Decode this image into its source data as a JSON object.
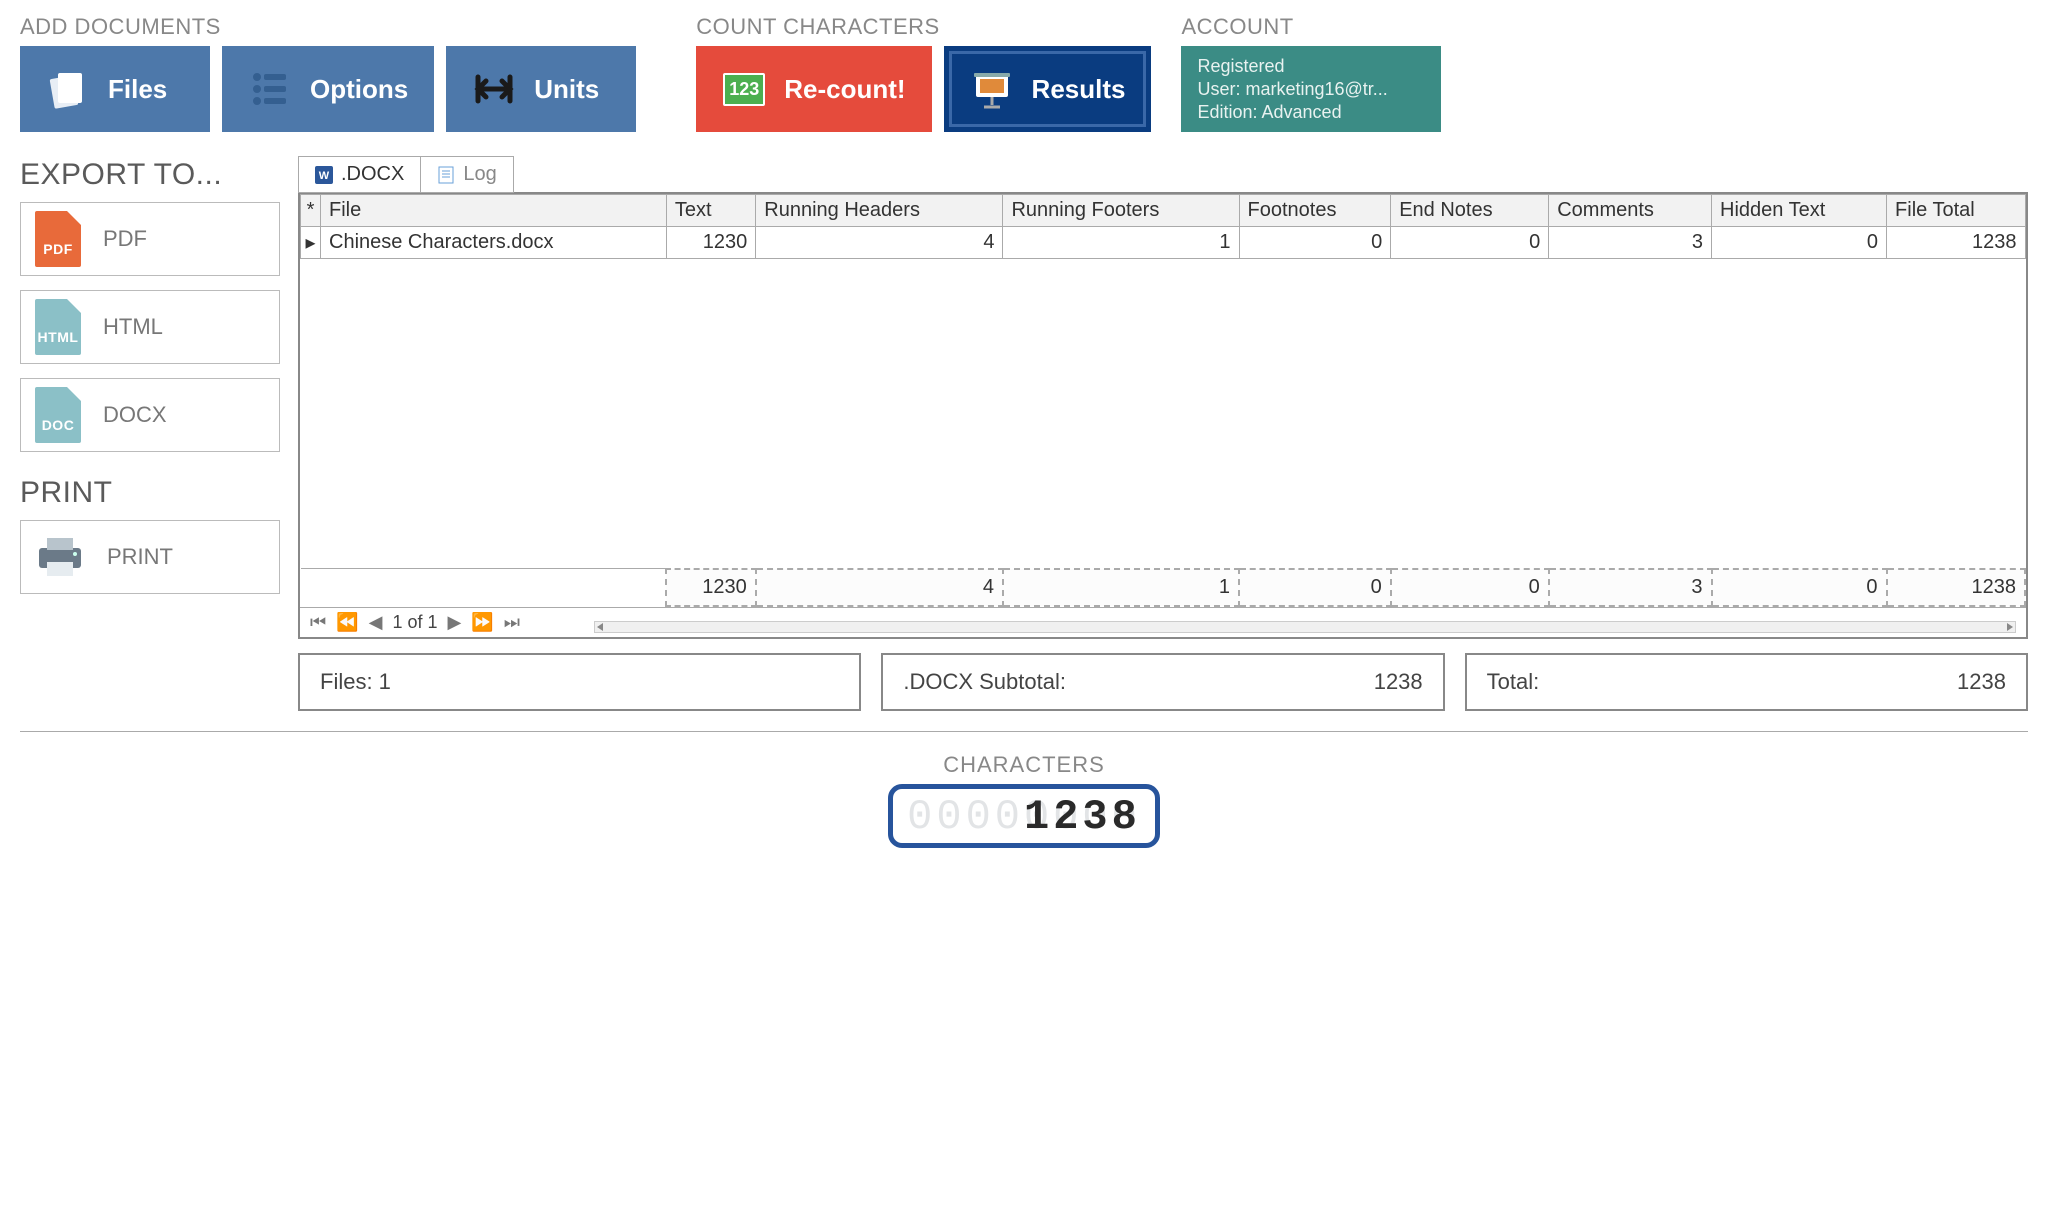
{
  "header": {
    "groups": {
      "add": "ADD DOCUMENTS",
      "count": "COUNT CHARACTERS",
      "account": "ACCOUNT"
    },
    "buttons": {
      "files": "Files",
      "options": "Options",
      "units": "Units",
      "recount": "Re-count!",
      "results": "Results"
    },
    "account": {
      "line1": "Registered",
      "line2": "User: marketing16@tr...",
      "line3": "Edition: Advanced"
    }
  },
  "sidebar": {
    "export_title": "EXPORT TO...",
    "pdf": "PDF",
    "html": "HTML",
    "docx": "DOCX",
    "print_title": "PRINT",
    "print": "PRINT",
    "icon_pdf": "PDF",
    "icon_html": "HTML",
    "icon_docx": "DOC"
  },
  "tabs": {
    "docx": ".DOCX",
    "log": "Log"
  },
  "grid": {
    "star": "*",
    "marker": "▸",
    "cols": {
      "file": "File",
      "text": "Text",
      "rh": "Running Headers",
      "rf": "Running Footers",
      "fn": "Footnotes",
      "en": "End Notes",
      "cm": "Comments",
      "ht": "Hidden Text",
      "ft": "File Total"
    },
    "row": {
      "file": "Chinese Characters.docx",
      "text": "1230",
      "rh": "4",
      "rf": "1",
      "fn": "0",
      "en": "0",
      "cm": "3",
      "ht": "0",
      "ft": "1238"
    },
    "totals": {
      "text": "1230",
      "rh": "4",
      "rf": "1",
      "fn": "0",
      "en": "0",
      "cm": "3",
      "ht": "0",
      "ft": "1238"
    },
    "pager": "1 of 1"
  },
  "summary": {
    "files_lbl": "Files: 1",
    "sub_lbl": ".DOCX Subtotal:",
    "sub_val": "1238",
    "tot_lbl": "Total:",
    "tot_val": "1238"
  },
  "characters": {
    "title": "CHARACTERS",
    "bg": "00000000",
    "value": "1238"
  }
}
